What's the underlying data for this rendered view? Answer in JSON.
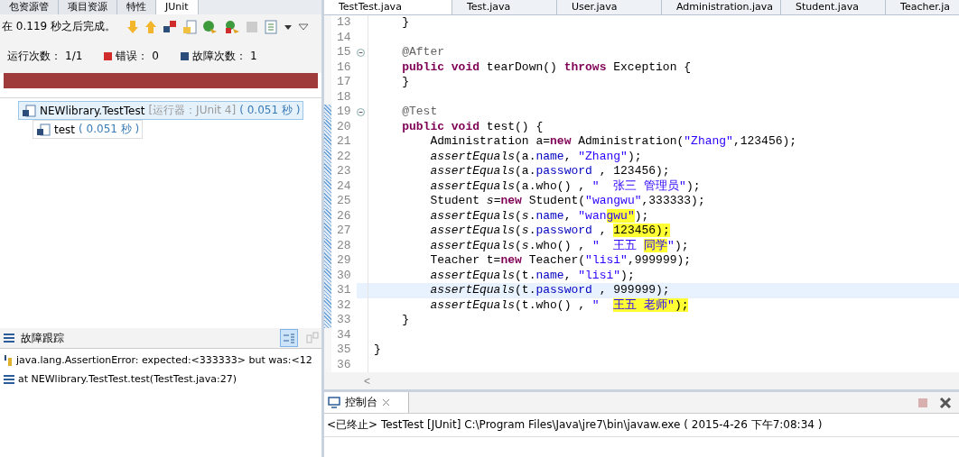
{
  "left_tabs": [
    {
      "label": "包资源管",
      "selected": false
    },
    {
      "label": "项目资源",
      "selected": false
    },
    {
      "label": "特性",
      "selected": false
    },
    {
      "label": "JUnit",
      "selected": true
    }
  ],
  "junit": {
    "status": "在 0.119 秒之后完成。",
    "counters": [
      {
        "kind": "runs",
        "label": "运行次数：",
        "value": "1/1"
      },
      {
        "kind": "errors",
        "label": "错误：",
        "value": "0"
      },
      {
        "kind": "failures",
        "label": "故障次数：",
        "value": "1"
      }
    ],
    "progress": {
      "level": 1,
      "failed": true
    },
    "tree": [
      {
        "name": "NEWlibrary.TestTest",
        "runner": "[运行器：JUnit 4]",
        "time": "( 0.051 秒 )",
        "selected": true,
        "children": [
          {
            "name": "test",
            "time": "( 0.051 秒 )",
            "selected": false
          }
        ]
      }
    ],
    "trace_title": "故障跟踪",
    "trace": [
      {
        "kind": "error",
        "text": "java.lang.AssertionError: expected:<333333> but was:<12"
      },
      {
        "kind": "frame",
        "text": "at NEWlibrary.TestTest.test(TestTest.java:27)"
      }
    ]
  },
  "editor_tabs": [
    {
      "label": "TestTest.java",
      "selected": true
    },
    {
      "label": "Test.java",
      "selected": false
    },
    {
      "label": "User.java",
      "selected": false
    },
    {
      "label": "Administration.java",
      "selected": false
    },
    {
      "label": "Student.java",
      "selected": false
    },
    {
      "label": "Teacher.ja",
      "selected": false
    }
  ],
  "code": [
    {
      "number": "13",
      "tokens": [
        {
          "kind": "plain",
          "text": "    }"
        }
      ]
    },
    {
      "number": "14"
    },
    {
      "number": "15",
      "fold": true,
      "tokens": [
        {
          "kind": "annotation",
          "text": "    @After"
        }
      ]
    },
    {
      "number": "16",
      "tokens": [
        {
          "kind": "keyword",
          "text": "    public void "
        },
        {
          "kind": "plain",
          "text": "tearDown() "
        },
        {
          "kind": "keyword",
          "text": "throws "
        },
        {
          "kind": "plain",
          "text": "Exception {"
        }
      ]
    },
    {
      "number": "17",
      "tokens": [
        {
          "kind": "plain",
          "text": "    }"
        }
      ]
    },
    {
      "number": "18"
    },
    {
      "number": "19",
      "fold": true,
      "changed": true,
      "tokens": [
        {
          "kind": "annotation",
          "text": "    @Test"
        }
      ]
    },
    {
      "number": "20",
      "changed": true,
      "tokens": [
        {
          "kind": "keyword",
          "text": "    public void "
        },
        {
          "kind": "plain",
          "text": "test() {"
        }
      ]
    },
    {
      "number": "21",
      "changed": true,
      "tokens": [
        {
          "kind": "plain",
          "text": "        Administration a="
        },
        {
          "kind": "keyword",
          "text": "new "
        },
        {
          "kind": "plain",
          "text": "Administration("
        },
        {
          "kind": "string",
          "text": "\"Zhang\""
        },
        {
          "kind": "plain",
          "text": ",123456);"
        }
      ]
    },
    {
      "number": "22",
      "changed": true,
      "tokens": [
        {
          "kind": "static",
          "text": "        assertEquals"
        },
        {
          "kind": "plain",
          "text": "(a."
        },
        {
          "kind": "field",
          "text": "name"
        },
        {
          "kind": "plain",
          "text": ", "
        },
        {
          "kind": "string",
          "text": "\"Zhang\""
        },
        {
          "kind": "plain",
          "text": ");"
        }
      ]
    },
    {
      "number": "23",
      "changed": true,
      "tokens": [
        {
          "kind": "static",
          "text": "        assertEquals"
        },
        {
          "kind": "plain",
          "text": "(a."
        },
        {
          "kind": "field",
          "text": "password"
        },
        {
          "kind": "plain",
          "text": " , 123456);"
        }
      ]
    },
    {
      "number": "24",
      "changed": true,
      "tokens": [
        {
          "kind": "static",
          "text": "        assertEquals"
        },
        {
          "kind": "plain",
          "text": "(a.who() , "
        },
        {
          "kind": "string",
          "text": "\"  张三 管理员\""
        },
        {
          "kind": "plain",
          "text": ");"
        }
      ]
    },
    {
      "number": "25",
      "changed": true,
      "tokens": [
        {
          "kind": "plain",
          "text": "        Student "
        },
        {
          "kind": "local",
          "text": "s"
        },
        {
          "kind": "plain",
          "text": "="
        },
        {
          "kind": "keyword",
          "text": "new "
        },
        {
          "kind": "plain",
          "text": "Student("
        },
        {
          "kind": "string",
          "text": "\"wangwu\""
        },
        {
          "kind": "plain",
          "text": ",333333);"
        }
      ]
    },
    {
      "number": "26",
      "changed": true,
      "tokens": [
        {
          "kind": "static",
          "text": "        assertEquals"
        },
        {
          "kind": "plain",
          "text": "("
        },
        {
          "kind": "local",
          "text": "s"
        },
        {
          "kind": "plain",
          "text": "."
        },
        {
          "kind": "field",
          "text": "name"
        },
        {
          "kind": "plain",
          "text": ", "
        },
        {
          "kind": "string",
          "text": "\"wan"
        },
        {
          "kind": "string",
          "text": "gwu\"",
          "highlighted": true
        },
        {
          "kind": "plain",
          "text": ");"
        }
      ]
    },
    {
      "number": "27",
      "changed": true,
      "tokens": [
        {
          "kind": "static",
          "text": "        assertEquals"
        },
        {
          "kind": "plain",
          "text": "("
        },
        {
          "kind": "local",
          "text": "s"
        },
        {
          "kind": "plain",
          "text": "."
        },
        {
          "kind": "field",
          "text": "password"
        },
        {
          "kind": "plain",
          "text": " , "
        },
        {
          "kind": "plain",
          "text": "123456);",
          "highlighted": true
        }
      ]
    },
    {
      "number": "28",
      "changed": true,
      "tokens": [
        {
          "kind": "static",
          "text": "        assertEquals"
        },
        {
          "kind": "plain",
          "text": "("
        },
        {
          "kind": "local",
          "text": "s"
        },
        {
          "kind": "plain",
          "text": ".who() , "
        },
        {
          "kind": "string",
          "text": "\"  王五 "
        },
        {
          "kind": "string",
          "text": "同学",
          "highlighted": true
        },
        {
          "kind": "string",
          "text": "\""
        },
        {
          "kind": "plain",
          "text": ");"
        }
      ]
    },
    {
      "number": "29",
      "changed": true,
      "tokens": [
        {
          "kind": "plain",
          "text": "        Teacher t="
        },
        {
          "kind": "keyword",
          "text": "new "
        },
        {
          "kind": "plain",
          "text": "Teacher("
        },
        {
          "kind": "string",
          "text": "\"lisi\""
        },
        {
          "kind": "plain",
          "text": ",999999);"
        }
      ]
    },
    {
      "number": "30",
      "changed": true,
      "tokens": [
        {
          "kind": "static",
          "text": "        assertEquals"
        },
        {
          "kind": "plain",
          "text": "(t."
        },
        {
          "kind": "field",
          "text": "name"
        },
        {
          "kind": "plain",
          "text": ", "
        },
        {
          "kind": "string",
          "text": "\"lisi\""
        },
        {
          "kind": "plain",
          "text": ");"
        }
      ]
    },
    {
      "number": "31",
      "changed": true,
      "current": true,
      "tokens": [
        {
          "kind": "static",
          "text": "        assertEquals"
        },
        {
          "kind": "plain",
          "text": "(t."
        },
        {
          "kind": "field",
          "text": "password"
        },
        {
          "kind": "plain",
          "text": " , 999999);"
        }
      ]
    },
    {
      "number": "32",
      "changed": true,
      "tokens": [
        {
          "kind": "static",
          "text": "        assertEquals"
        },
        {
          "kind": "plain",
          "text": "(t.who() , "
        },
        {
          "kind": "string",
          "text": "\"  "
        },
        {
          "kind": "string",
          "text": "王五 老师\"",
          "highlighted": true
        },
        {
          "kind": "plain",
          "text": ");",
          "highlighted": true
        }
      ]
    },
    {
      "number": "33",
      "changed": true,
      "tokens": [
        {
          "kind": "plain",
          "text": "    }"
        }
      ]
    },
    {
      "number": "34"
    },
    {
      "number": "35",
      "tokens": [
        {
          "kind": "plain",
          "text": "}"
        }
      ]
    },
    {
      "number": "36"
    }
  ],
  "scroll_arrow": "<",
  "console": {
    "tab": "控制台",
    "status": "<已终止> TestTest [JUnit] C:\\Program Files\\Java\\jre7\\bin\\javaw.exe ( 2015-4-26 下午7:08:34 )"
  }
}
